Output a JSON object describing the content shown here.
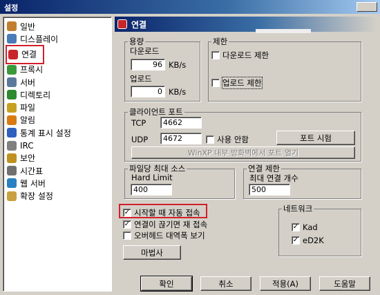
{
  "window": {
    "title": "설정"
  },
  "sidebar": {
    "items": [
      {
        "label": "일반",
        "icon": "gear-icon",
        "color": "#c08030"
      },
      {
        "label": "디스플레이",
        "icon": "display-icon",
        "color": "#4a7ab8"
      },
      {
        "label": "연결",
        "icon": "plug-icon",
        "color": "#c8262a",
        "selected": true
      },
      {
        "label": "프록시",
        "icon": "proxy-icon",
        "color": "#3a9a3a"
      },
      {
        "label": "서버",
        "icon": "server-icon",
        "color": "#5a7a9a"
      },
      {
        "label": "디렉토리",
        "icon": "folder-icon",
        "color": "#2e8a2e"
      },
      {
        "label": "파일",
        "icon": "file-icon",
        "color": "#c8a020"
      },
      {
        "label": "알림",
        "icon": "bell-icon",
        "color": "#d87a10"
      },
      {
        "label": "통계 표시 설정",
        "icon": "stats-icon",
        "color": "#3060c0"
      },
      {
        "label": "IRC",
        "icon": "irc-icon",
        "color": "#808080"
      },
      {
        "label": "보안",
        "icon": "lock-icon",
        "color": "#c09020"
      },
      {
        "label": "시간표",
        "icon": "calendar-icon",
        "color": "#707070"
      },
      {
        "label": "웹 서버",
        "icon": "globe-icon",
        "color": "#2a80c0"
      },
      {
        "label": "확장 설정",
        "icon": "extensions-icon",
        "color": "#c8a040"
      }
    ]
  },
  "panel": {
    "title": "연결",
    "accent": "#c8262a"
  },
  "capacity": {
    "legend": "용량",
    "download_label": "다운로드",
    "download_value": "96",
    "download_unit": "KB/s",
    "upload_label": "업로드",
    "upload_value": "0",
    "upload_unit": "KB/s"
  },
  "limits": {
    "legend": "제한",
    "download_limit_label": "다운로드 제한",
    "upload_limit_label": "업로드 제한"
  },
  "client_port": {
    "legend": "클라이언트 포트",
    "tcp_label": "TCP",
    "tcp_value": "4662",
    "udp_label": "UDP",
    "udp_value": "4672",
    "disable_label": "사용 안함",
    "port_test_button": "포트 시험",
    "winxp_button": "WinXP 내부 방화벽에서 포트 열기"
  },
  "max_sources": {
    "legend": "파일당 최대 소스",
    "hard_limit_label": "Hard Limit",
    "hard_limit_value": "400"
  },
  "connection_limit": {
    "legend": "연결 제한",
    "max_connections_label": "최대 연결 개수",
    "max_connections_value": "500"
  },
  "options": {
    "autoconnect_label": "시작할 때 자동 접속",
    "reconnect_label": "연결이 끊기면 재 접속",
    "overhead_label": "오버헤드 대역폭 보기"
  },
  "network": {
    "legend": "네트워크",
    "kad_label": "Kad",
    "ed2k_label": "eD2K"
  },
  "wizard_button": "마법사",
  "footer": {
    "ok": "확인",
    "cancel": "취소",
    "apply": "적용(A)",
    "help": "도움말"
  }
}
